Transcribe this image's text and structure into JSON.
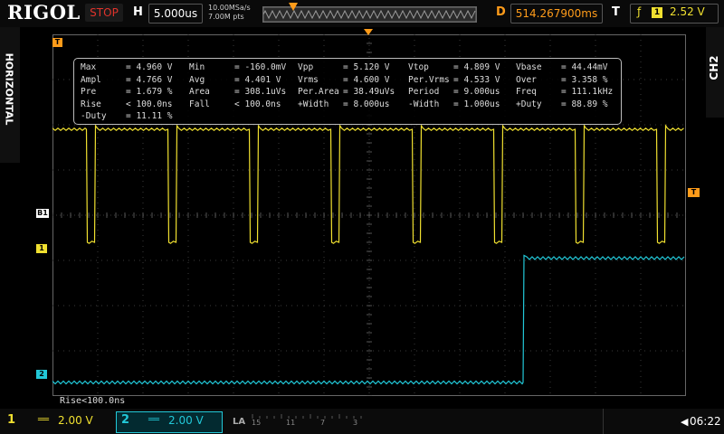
{
  "header": {
    "brand": "RIGOL",
    "run_state": "STOP",
    "h_label": "H",
    "timebase": "5.000us",
    "sample_rate": "10.00MSa/s",
    "mem_depth": "7.00M pts",
    "d_label": "D",
    "delay": "514.267900ms",
    "t_label": "T",
    "trigger_source": "1",
    "trigger_level": "2.52 V"
  },
  "side": {
    "horizontal_label": "HORIZONTAL",
    "ch2_label": "CH2"
  },
  "markers": {
    "trigger_top": "T",
    "trigger_right": "T",
    "ch1": "1",
    "ch2": "2",
    "bus": "B1"
  },
  "measurements": {
    "rows": [
      [
        {
          "name": "Max",
          "value": "= 4.960 V"
        },
        {
          "name": "Min",
          "value": "= -160.0mV"
        },
        {
          "name": "Vpp",
          "value": "= 5.120 V"
        },
        {
          "name": "Vtop",
          "value": "= 4.809 V"
        },
        {
          "name": "Vbase",
          "value": "= 44.44mV"
        }
      ],
      [
        {
          "name": "Ampl",
          "value": "= 4.766 V"
        },
        {
          "name": "Avg",
          "value": "= 4.401 V"
        },
        {
          "name": "Vrms",
          "value": "= 4.600 V"
        },
        {
          "name": "Per.Vrms",
          "value": "= 4.533 V"
        },
        {
          "name": "Over",
          "value": "= 3.358 %"
        }
      ],
      [
        {
          "name": "Pre",
          "value": "= 1.679 %"
        },
        {
          "name": "Area",
          "value": "= 308.1uVs"
        },
        {
          "name": "Per.Area",
          "value": "= 38.49uVs"
        },
        {
          "name": "Period",
          "value": "= 9.000us"
        },
        {
          "name": "Freq",
          "value": "= 111.1kHz"
        }
      ],
      [
        {
          "name": "Rise",
          "value": "< 100.0ns"
        },
        {
          "name": "Fall",
          "value": "< 100.0ns"
        },
        {
          "name": "+Width",
          "value": "= 8.000us"
        },
        {
          "name": "-Width",
          "value": "= 1.000us"
        },
        {
          "name": "+Duty",
          "value": "= 88.89 %"
        }
      ],
      [
        {
          "name": "-Duty",
          "value": "= 11.11 %"
        }
      ]
    ]
  },
  "status_text": "Rise<100.0ns",
  "footer": {
    "ch1": {
      "num": "1",
      "coupling": "══",
      "scale": "2.00 V"
    },
    "ch2": {
      "num": "2",
      "coupling": "══",
      "scale": "2.00 V"
    },
    "la_label": "LA",
    "la_channels": [
      "15",
      "11",
      "7",
      "3"
    ],
    "time": "06:22"
  },
  "colors": {
    "ch1": "#f0e030",
    "ch2": "#22c8d8",
    "trigger": "#ff9c1a",
    "grid": "#3a3a3a"
  },
  "waveforms": {
    "ch1": {
      "period_div": 1.8,
      "neg_width_div": 0.2,
      "first_fall_div": 0.75,
      "high_div": 5.9,
      "low_div": 3.4
    },
    "ch2": {
      "step_div": 10.4,
      "low_div": 0.3,
      "high_div": 3.05
    }
  }
}
